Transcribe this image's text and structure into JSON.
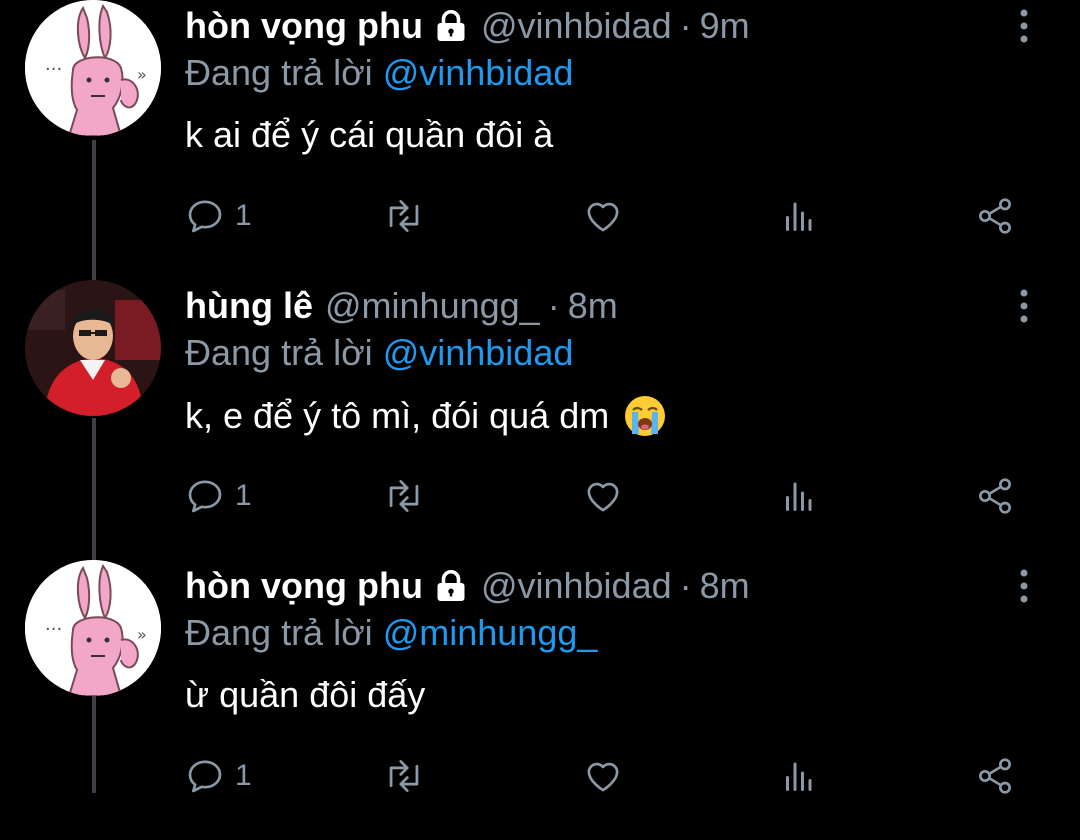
{
  "tweets": [
    {
      "name": "hòn vọng phu",
      "protected": true,
      "handle": "@vinhbidad",
      "separator": "·",
      "time": "9m",
      "replying_prefix": "Đang trả lời",
      "replying_to": "@vinhbidad",
      "text": "k ai để ý cái quần đôi à",
      "emoji": "",
      "reply_count": "1",
      "avatar": "bunny-avatar"
    },
    {
      "name": "hùng lê",
      "protected": false,
      "handle": "@minhungg_",
      "separator": "·",
      "time": "8m",
      "replying_prefix": "Đang trả lời",
      "replying_to": "@vinhbidad",
      "text": "k, e để ý tô mì, đói quá dm",
      "emoji": "loudly-crying-face",
      "reply_count": "1",
      "avatar": "photo-avatar"
    },
    {
      "name": "hòn vọng phu",
      "protected": true,
      "handle": "@vinhbidad",
      "separator": "·",
      "time": "8m",
      "replying_prefix": "Đang trả lời",
      "replying_to": "@minhungg_",
      "text": "ừ quần đôi đấy",
      "emoji": "",
      "reply_count": "1",
      "avatar": "bunny-avatar"
    }
  ],
  "colors": {
    "background": "#000000",
    "text": "#ffffff",
    "muted": "#8b98a5",
    "mention": "#1d9bf0",
    "thread_line": "#3d4145"
  },
  "icons": [
    "lock-icon",
    "more-vertical-icon",
    "reply-icon",
    "retweet-icon",
    "like-icon",
    "stats-icon",
    "share-icon"
  ]
}
